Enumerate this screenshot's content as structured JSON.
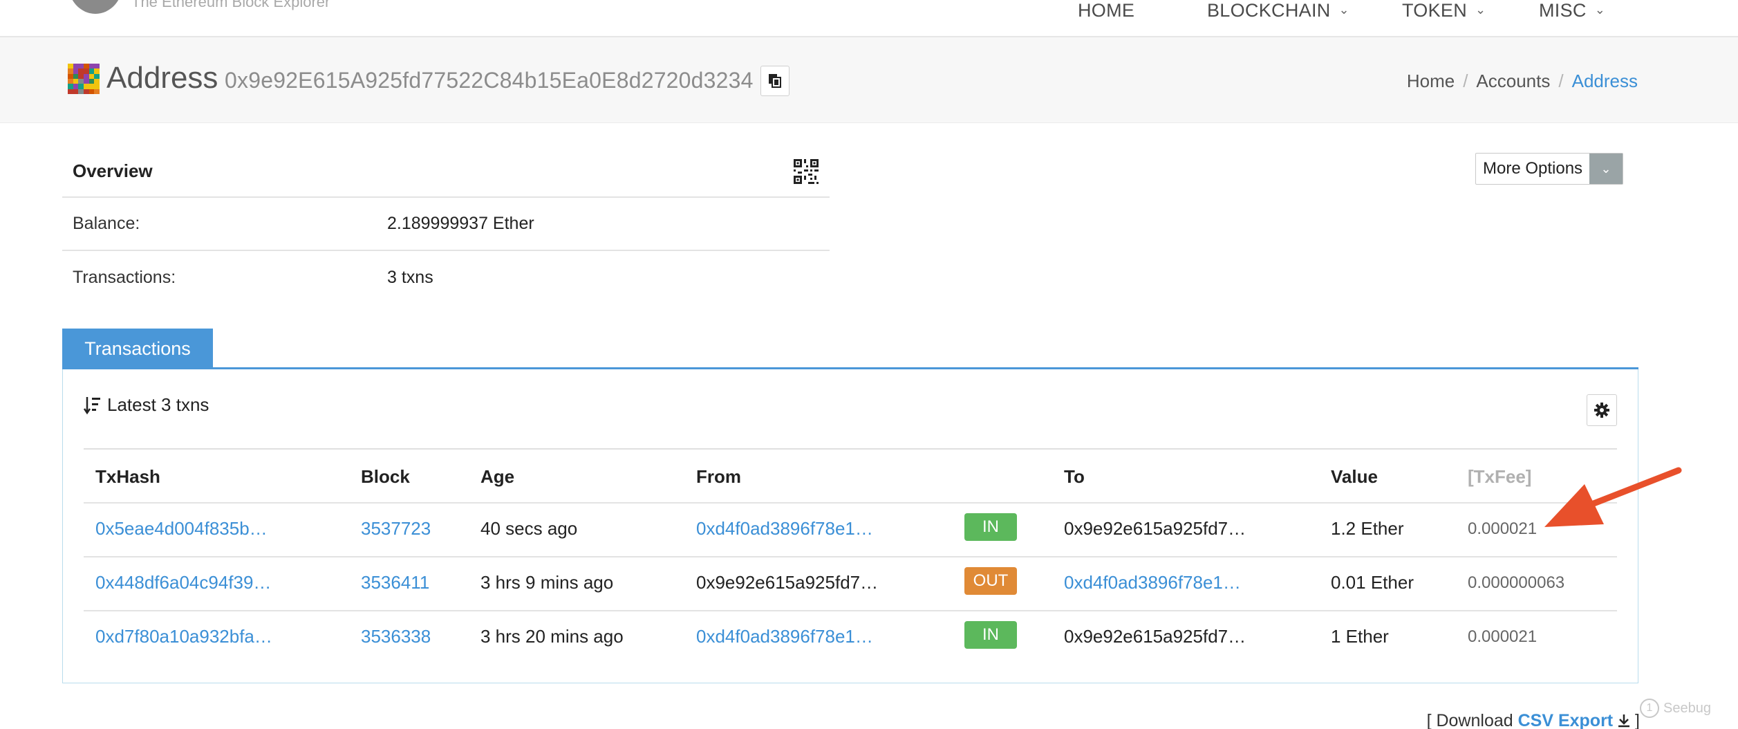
{
  "brand": {
    "tagline": "The Ethereum Block Explorer"
  },
  "nav": {
    "home": "HOME",
    "blockchain": "BLOCKCHAIN",
    "token": "TOKEN",
    "misc": "MISC"
  },
  "header": {
    "title": "Address",
    "address": "0x9e92E615A925fd77522C84b15Ea0E8d2720d3234",
    "breadcrumb": [
      "Home",
      "Accounts",
      "Address"
    ],
    "separator": "/"
  },
  "overview": {
    "title": "Overview",
    "balance_label": "Balance:",
    "balance_value": "2.189999937 Ether",
    "txns_label": "Transactions:",
    "txns_value": "3 txns"
  },
  "more_options": {
    "label": "More Options"
  },
  "tabs": {
    "transactions": "Transactions"
  },
  "txn_table": {
    "summary": "Latest 3 txns",
    "headers": {
      "txhash": "TxHash",
      "block": "Block",
      "age": "Age",
      "from": "From",
      "to": "To",
      "value": "Value",
      "txfee": "[TxFee]"
    },
    "rows": [
      {
        "hash": "0x5eae4d004f835b…",
        "block": "3537723",
        "age": "40 secs ago",
        "from": "0xd4f0ad3896f78e1…",
        "direction": "IN",
        "to": "0x9e92e615a925fd7…",
        "value": "1.2 Ether",
        "fee": "0.000021"
      },
      {
        "hash": "0x448df6a04c94f39…",
        "block": "3536411",
        "age": "3 hrs 9 mins ago",
        "from": "0x9e92e615a925fd7…",
        "direction": "OUT",
        "to": "0xd4f0ad3896f78e1…",
        "value": "0.01 Ether",
        "fee": "0.000000063"
      },
      {
        "hash": "0xd7f80a10a932bfa…",
        "block": "3536338",
        "age": "3 hrs 20 mins ago",
        "from": "0xd4f0ad3896f78e1…",
        "direction": "IN",
        "to": "0x9e92e615a925fd7…",
        "value": "1 Ether",
        "fee": "0.000021"
      }
    ]
  },
  "footer": {
    "download_prefix": "[ Download",
    "csv_label": "CSV Export",
    "download_suffix": "]"
  },
  "watermark": {
    "text": "Seebug",
    "glyph": "1"
  },
  "colors": {
    "accent": "#4a97d8",
    "link": "#3b8fd6",
    "badge_in": "#5cb85c",
    "badge_out": "#e08a36",
    "arrow": "#e8502b"
  },
  "icons": [
    "chevron-down-icon",
    "copy-icon",
    "qr-code-icon",
    "sort-icon",
    "gear-icon",
    "download-icon",
    "arrow-annotation"
  ]
}
